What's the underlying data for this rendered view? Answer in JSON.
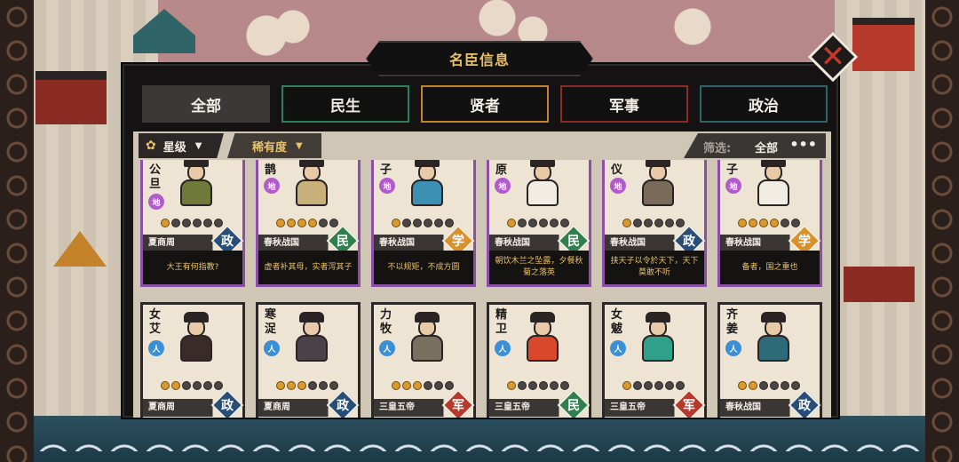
{
  "window": {
    "title": "名臣信息"
  },
  "tabs": [
    {
      "label": "全部",
      "active": true
    },
    {
      "label": "民生",
      "active": false
    },
    {
      "label": "贤者",
      "active": false
    },
    {
      "label": "军事",
      "active": false
    },
    {
      "label": "政治",
      "active": false
    }
  ],
  "filters": {
    "star_label": "星级",
    "rarity_label": "稀有度",
    "filter_label": "筛选:",
    "filter_value": "全部"
  },
  "colors": {
    "accent_gold": "#e9c16a",
    "tab_green": "#2f7f5f",
    "tab_gold": "#c4832a",
    "tab_red": "#8a2b24",
    "tab_teal": "#2f6468",
    "rare_purple": "#8b4fa5"
  },
  "cards_row1": [
    {
      "name": "公旦",
      "grade": "地",
      "stars": 1,
      "era": "夏商周",
      "type": "政",
      "quote": "大王有何指教?",
      "robe": "#6f7a3a"
    },
    {
      "name": "鹊",
      "grade": "地",
      "stars": 4,
      "era": "春秋战国",
      "type": "民",
      "quote": "虚者补其母，实者泻其子",
      "robe": "#c7b07a"
    },
    {
      "name": "子",
      "grade": "地",
      "stars": 1,
      "era": "春秋战国",
      "type": "学",
      "quote": "不以规矩，不成方圆",
      "robe": "#3b8fb0"
    },
    {
      "name": "原",
      "grade": "地",
      "stars": 1,
      "era": "春秋战国",
      "type": "民",
      "quote": "朝饮木兰之坠露，夕餐秋菊之落英",
      "robe": "#f1ece4"
    },
    {
      "name": "仪",
      "grade": "地",
      "stars": 1,
      "era": "春秋战国",
      "type": "政",
      "quote": "挟天子以令於天下，天下莫敢不听",
      "robe": "#7a6a5a"
    },
    {
      "name": "子",
      "grade": "地",
      "stars": 4,
      "era": "春秋战国",
      "type": "学",
      "quote": "备者，国之重也",
      "robe": "#f1ece4"
    }
  ],
  "cards_row2": [
    {
      "name": "女艾",
      "grade": "人",
      "stars": 2,
      "era": "夏商周",
      "type": "政",
      "robe": "#3a2a2a"
    },
    {
      "name": "寒浞",
      "grade": "人",
      "stars": 3,
      "era": "夏商周",
      "type": "政",
      "robe": "#4a4248"
    },
    {
      "name": "力牧",
      "grade": "人",
      "stars": 3,
      "era": "三皇五帝",
      "type": "军",
      "robe": "#7a7060"
    },
    {
      "name": "精卫",
      "grade": "人",
      "stars": 1,
      "era": "三皇五帝",
      "type": "民",
      "robe": "#d9482b"
    },
    {
      "name": "女魃",
      "grade": "人",
      "stars": 1,
      "era": "三皇五帝",
      "type": "军",
      "robe": "#2fa08a"
    },
    {
      "name": "齐姜",
      "grade": "人",
      "stars": 2,
      "era": "春秋战国",
      "type": "政",
      "robe": "#2f6a78"
    }
  ]
}
